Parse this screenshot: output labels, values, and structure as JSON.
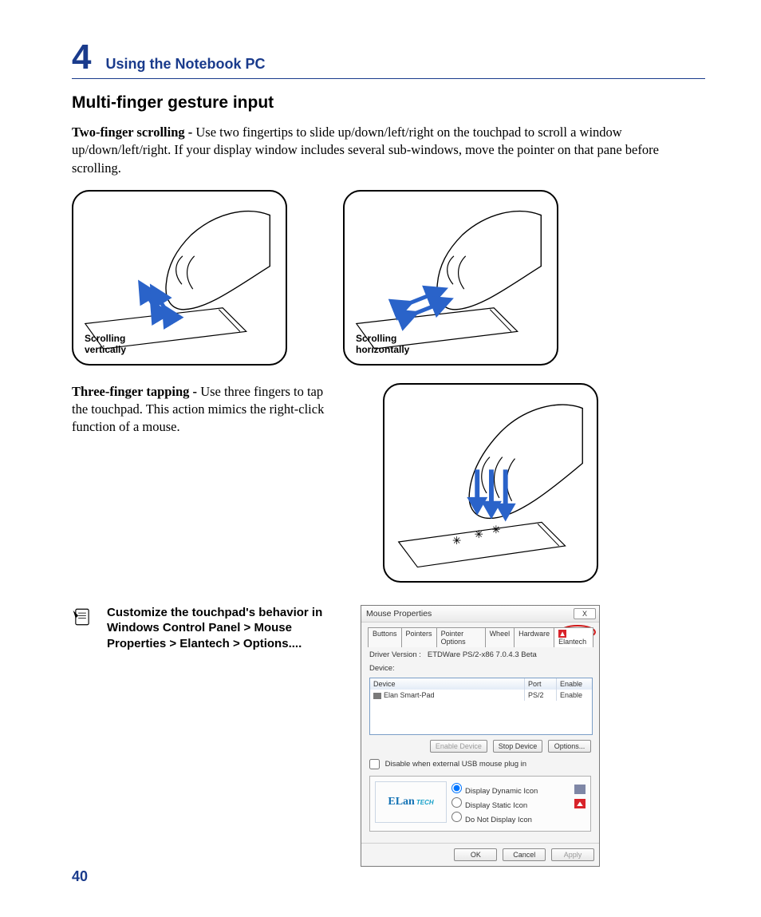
{
  "chapter": {
    "number": "4",
    "title": "Using the Notebook PC"
  },
  "section_title": "Multi-finger gesture input",
  "two_finger": {
    "label": "Two-finger scrolling - ",
    "text": "Use two fingertips to slide up/down/left/right on the touchpad to scroll a window up/down/left/right. If your display window includes several sub-windows, move the pointer on that pane before scrolling."
  },
  "fig1_caption_l1": "Scrolling",
  "fig1_caption_l2": "vertically",
  "fig2_caption_l1": "Scrolling",
  "fig2_caption_l2": "horizontally",
  "three_finger": {
    "label": "Three-finger tapping - ",
    "text": "Use three fingers to tap the touchpad. This action mimics the right-click function of a mouse."
  },
  "note_text": "Customize the touchpad's behavior in Windows Control Panel > Mouse Properties > Elantech > Options....",
  "dialog": {
    "title": "Mouse Properties",
    "close": "X",
    "tabs": [
      "Buttons",
      "Pointers",
      "Pointer Options",
      "Wheel",
      "Hardware",
      "Elantech"
    ],
    "driver_label": "Driver Version :",
    "driver_value": "ETDWare PS/2-x86 7.0.4.3 Beta",
    "device_label": "Device:",
    "cols": {
      "device": "Device",
      "port": "Port",
      "enable": "Enable"
    },
    "row": {
      "device": "Elan Smart-Pad",
      "port": "PS/2",
      "enable": "Enable"
    },
    "btn_enable": "Enable Device",
    "btn_stop": "Stop Device",
    "btn_options": "Options...",
    "chk_label": "Disable when external USB mouse plug in",
    "radio_dynamic": "Display Dynamic Icon",
    "radio_static": "Display Static Icon",
    "radio_none": "Do Not Display Icon",
    "logo_main": "ELan",
    "logo_sub": "TECH",
    "ok": "OK",
    "cancel": "Cancel",
    "apply": "Apply"
  },
  "page_number": "40"
}
